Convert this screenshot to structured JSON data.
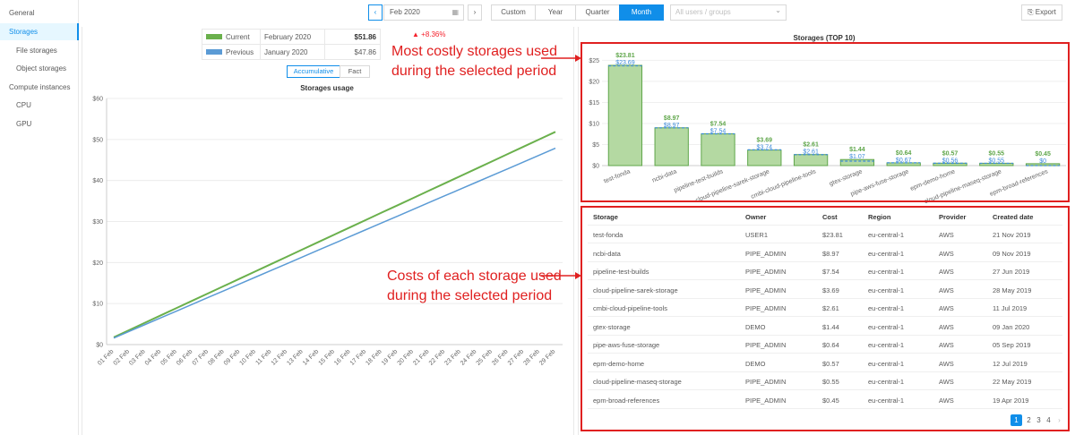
{
  "sidebar": {
    "items": [
      {
        "label": "General",
        "indent": 0,
        "active": false
      },
      {
        "label": "Storages",
        "indent": 0,
        "active": true
      },
      {
        "label": "File storages",
        "indent": 1,
        "active": false
      },
      {
        "label": "Object storages",
        "indent": 1,
        "active": false
      },
      {
        "label": "Compute instances",
        "indent": 0,
        "active": false
      },
      {
        "label": "CPU",
        "indent": 1,
        "active": false
      },
      {
        "label": "GPU",
        "indent": 1,
        "active": false
      }
    ]
  },
  "toolbar": {
    "prev_icon": "‹",
    "next_icon": "›",
    "date_value": "Feb 2020",
    "calendar_icon": "▦",
    "periods": [
      "Custom",
      "Year",
      "Quarter",
      "Month"
    ],
    "active_period": "Month",
    "filter_placeholder": "All users / groups",
    "filter_chevron": "⌄",
    "export_icon": "⎘",
    "export_label": "Export"
  },
  "summary": {
    "current_label": "Current",
    "current_period": "February 2020",
    "current_value": "$51.86",
    "previous_label": "Previous",
    "previous_period": "January 2020",
    "previous_value": "$47.86",
    "delta": "▲ +8.36%",
    "current_color": "#6ab04c",
    "previous_color": "#5b9bd5"
  },
  "usage_toggle": {
    "accumulative": "Accumulative",
    "fact": "Fact"
  },
  "chart_data": [
    {
      "type": "line",
      "title": "Storages usage",
      "x": [
        "01 Feb",
        "02 Feb",
        "03 Feb",
        "04 Feb",
        "05 Feb",
        "06 Feb",
        "07 Feb",
        "08 Feb",
        "09 Feb",
        "10 Feb",
        "11 Feb",
        "12 Feb",
        "13 Feb",
        "14 Feb",
        "15 Feb",
        "16 Feb",
        "17 Feb",
        "18 Feb",
        "19 Feb",
        "20 Feb",
        "21 Feb",
        "22 Feb",
        "23 Feb",
        "24 Feb",
        "25 Feb",
        "26 Feb",
        "27 Feb",
        "28 Feb",
        "29 Feb"
      ],
      "series": [
        {
          "name": "Current",
          "color": "#6ab04c",
          "start": 1.8,
          "end": 51.86
        },
        {
          "name": "Previous",
          "color": "#5b9bd5",
          "start": 1.6,
          "end": 47.86
        }
      ],
      "ylim": [
        0,
        60
      ],
      "yticks": [
        "$0",
        "$10",
        "$20",
        "$30",
        "$40",
        "$50",
        "$60"
      ],
      "grid": true
    },
    {
      "type": "bar",
      "title": "Storages (TOP 10)",
      "categories": [
        "test-fonda",
        "ncbi-data",
        "pipeline-test-builds",
        "cloud-pipeline-sarek-storage",
        "cmbi-cloud-pipeline-tools",
        "gtex-storage",
        "pipe-aws-fuse-storage",
        "epm-demo-home",
        "cloud-pipeline-maseq-storage",
        "epm-broad-references"
      ],
      "series": [
        {
          "name": "Current",
          "values": [
            23.81,
            8.97,
            7.54,
            3.69,
            2.61,
            1.44,
            0.64,
            0.57,
            0.55,
            0.45
          ],
          "labels": [
            "$23.81",
            "$8.97",
            "$7.54",
            "$3.69",
            "$2.61",
            "$1.44",
            "$0.64",
            "$0.57",
            "$0.55",
            "$0.45"
          ],
          "color": "#5fa64a"
        },
        {
          "name": "Previous",
          "values": [
            23.69,
            8.97,
            7.54,
            3.74,
            2.61,
            1.07,
            0.67,
            0.56,
            0.55,
            0
          ],
          "labels": [
            "$23.69",
            "$8.97",
            "$7.54",
            "$3.74",
            "$2.61",
            "$1.07",
            "$0.67",
            "$0.56",
            "$0.55",
            "$0"
          ],
          "color": "#3d8bd9"
        }
      ],
      "ylim": [
        0,
        27
      ],
      "yticks": [
        "$0",
        "$5",
        "$10",
        "$15",
        "$20",
        "$25"
      ]
    }
  ],
  "table": {
    "headers": [
      "Storage",
      "Owner",
      "Cost",
      "Region",
      "Provider",
      "Created date"
    ],
    "rows": [
      [
        "test-fonda",
        "USER1",
        "$23.81",
        "eu-central-1",
        "AWS",
        "21 Nov 2019"
      ],
      [
        "ncbi-data",
        "PIPE_ADMIN",
        "$8.97",
        "eu-central-1",
        "AWS",
        "09 Nov 2019"
      ],
      [
        "pipeline-test-builds",
        "PIPE_ADMIN",
        "$7.54",
        "eu-central-1",
        "AWS",
        "27 Jun 2019"
      ],
      [
        "cloud-pipeline-sarek-storage",
        "PIPE_ADMIN",
        "$3.69",
        "eu-central-1",
        "AWS",
        "28 May 2019"
      ],
      [
        "cmbi-cloud-pipeline-tools",
        "PIPE_ADMIN",
        "$2.61",
        "eu-central-1",
        "AWS",
        "11 Jul 2019"
      ],
      [
        "gtex-storage",
        "DEMO",
        "$1.44",
        "eu-central-1",
        "AWS",
        "09 Jan 2020"
      ],
      [
        "pipe-aws-fuse-storage",
        "PIPE_ADMIN",
        "$0.64",
        "eu-central-1",
        "AWS",
        "05 Sep 2019"
      ],
      [
        "epm-demo-home",
        "DEMO",
        "$0.57",
        "eu-central-1",
        "AWS",
        "12 Jul 2019"
      ],
      [
        "cloud-pipeline-maseq-storage",
        "PIPE_ADMIN",
        "$0.55",
        "eu-central-1",
        "AWS",
        "22 May 2019"
      ],
      [
        "epm-broad-references",
        "PIPE_ADMIN",
        "$0.45",
        "eu-central-1",
        "AWS",
        "19 Apr 2019"
      ]
    ]
  },
  "pagination": {
    "pages": [
      "1",
      "2",
      "3",
      "4"
    ],
    "active": "1",
    "next_icon": "›"
  },
  "annotations": {
    "top_line1": "Most costly storages used",
    "top_line2": "during the selected period",
    "bottom_line1": "Costs of each storage used",
    "bottom_line2": "during the selected period",
    "color": "#e02020"
  }
}
